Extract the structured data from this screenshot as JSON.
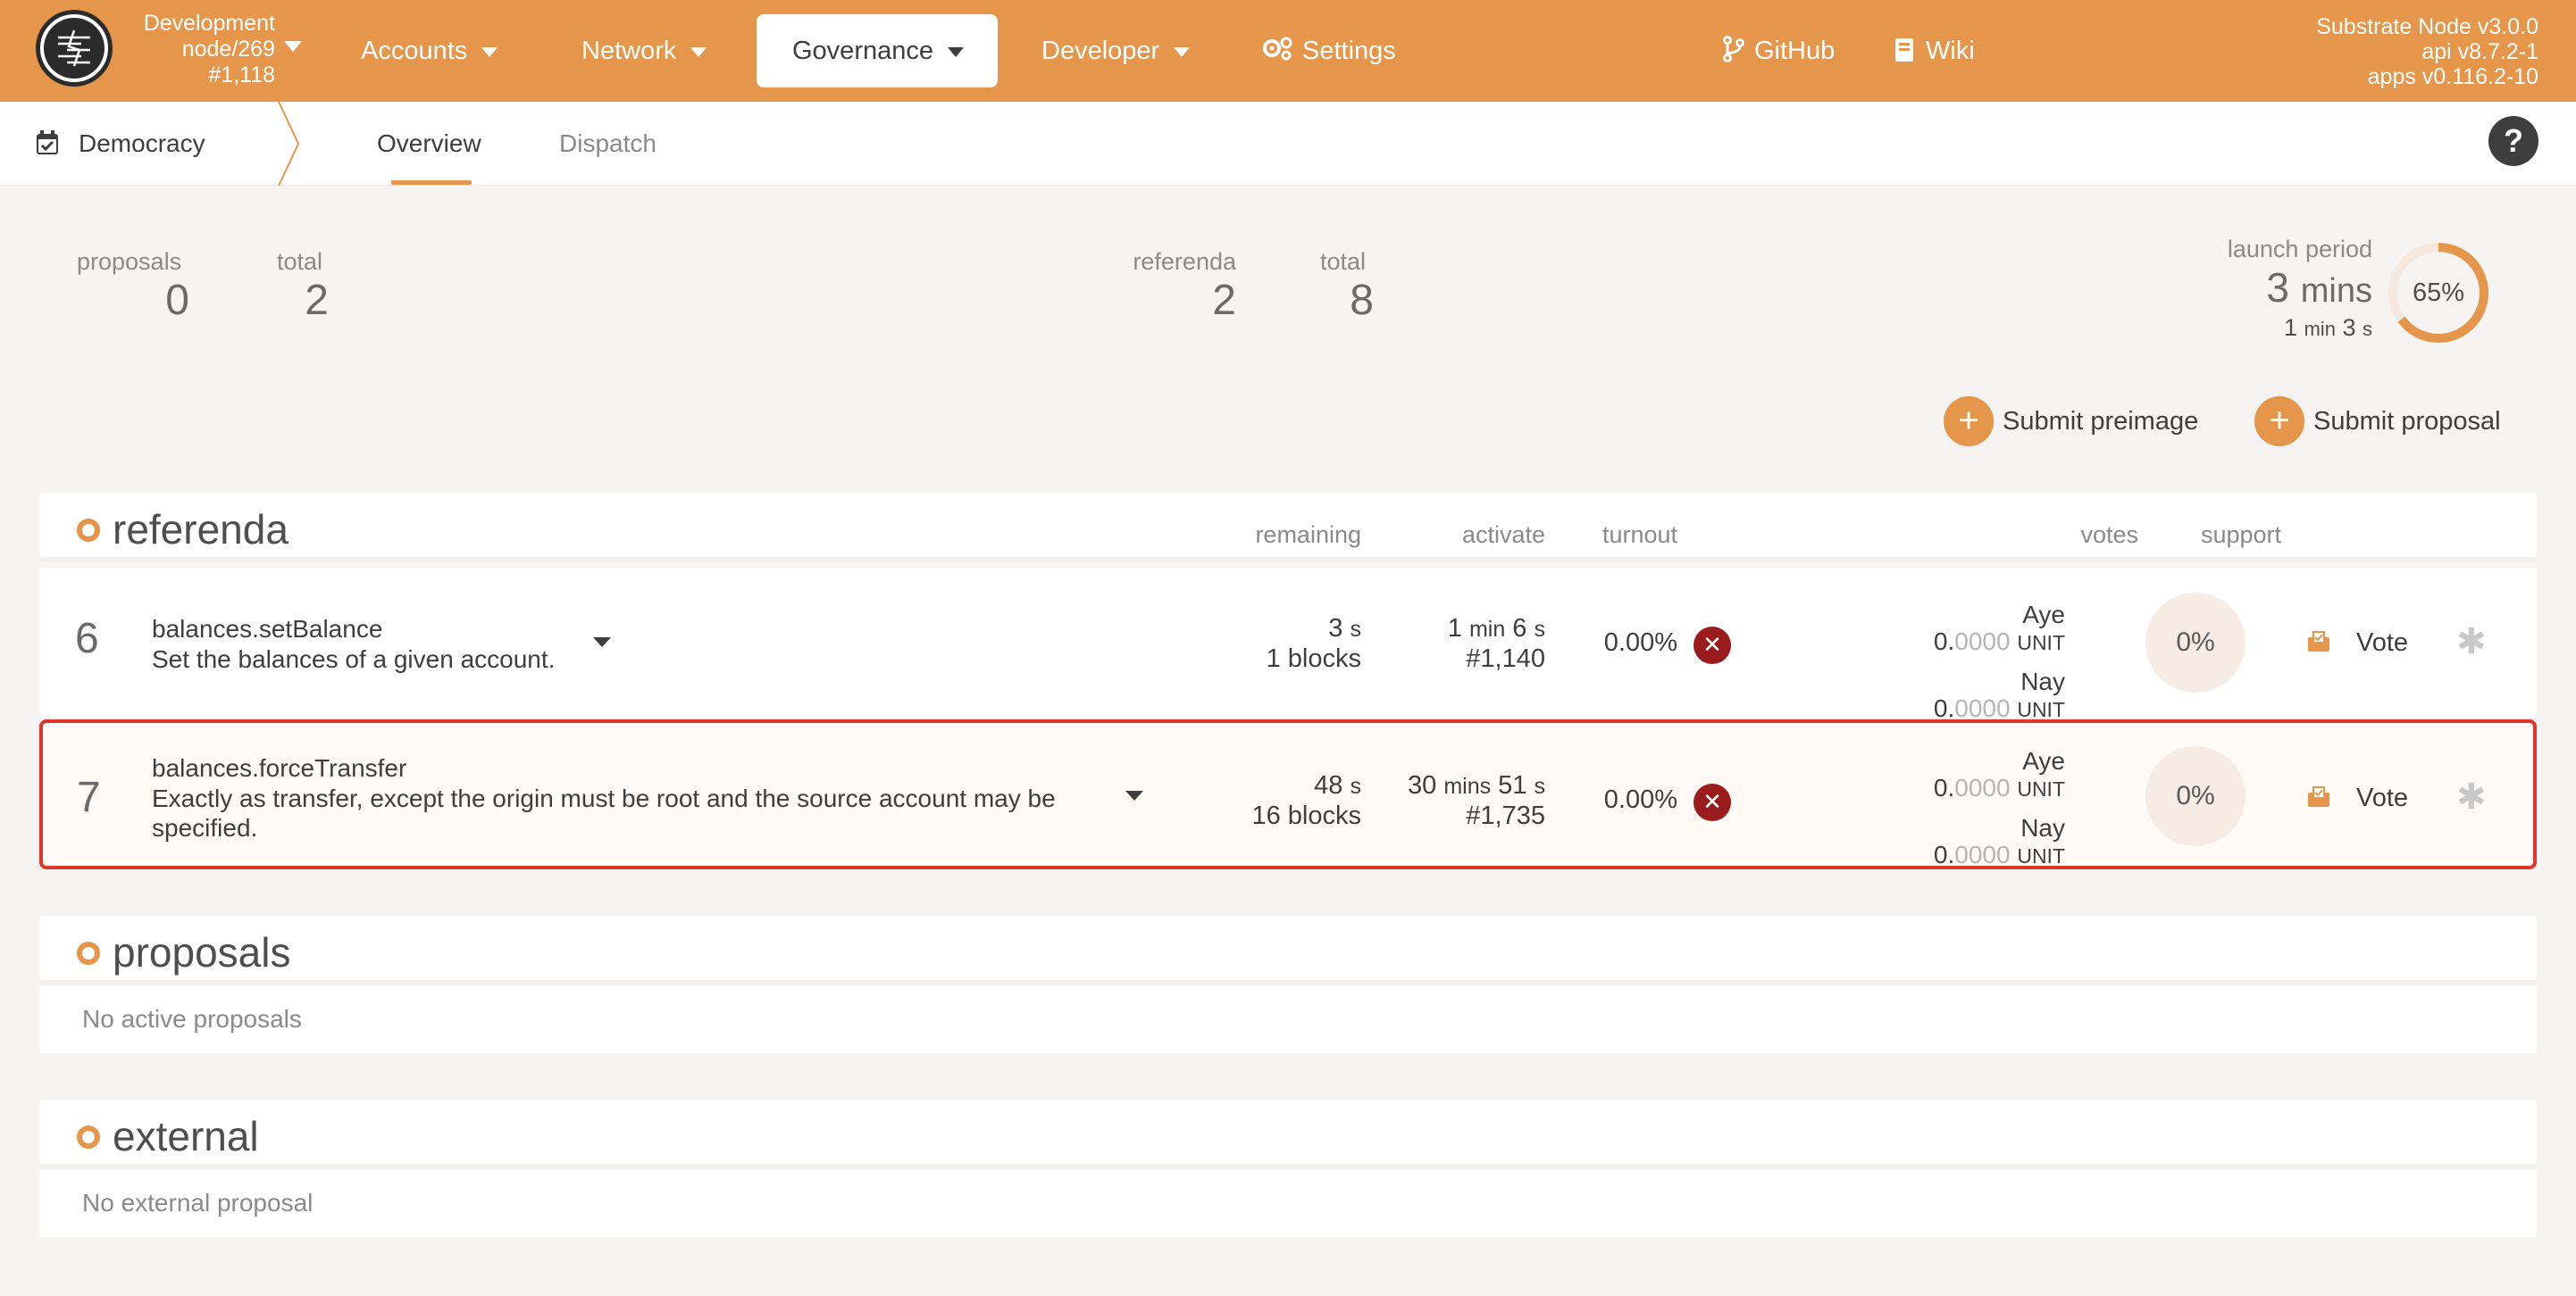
{
  "header": {
    "chain_name": "Development",
    "node": "node/269",
    "block": "#1,118",
    "nav": [
      "Accounts",
      "Network",
      "Governance",
      "Developer",
      "Settings"
    ],
    "github": "GitHub",
    "wiki": "Wiki",
    "version_node": "Substrate Node v3.0.0",
    "version_api": "api v8.7.2-1",
    "version_apps": "apps v0.116.2-10",
    "accent_color": "#e5964a"
  },
  "subnav": {
    "title": "Democracy",
    "tabs": [
      "Overview",
      "Dispatch"
    ],
    "help": "?"
  },
  "summary": {
    "proposals_label": "proposals",
    "proposals_value": "0",
    "proposals_total_label": "total",
    "proposals_total_value": "2",
    "referenda_label": "referenda",
    "referenda_value": "2",
    "referenda_total_label": "total",
    "referenda_total_value": "8",
    "launch_label": "launch period",
    "launch_big_num": "3",
    "launch_big_unit": "mins",
    "launch_small_min": "1",
    "launch_small_min_unit": "min",
    "launch_small_sec": "3",
    "launch_small_sec_unit": "s",
    "launch_percent_label": "65%",
    "launch_percent": 0.65
  },
  "actions": {
    "submit_preimage": "Submit preimage",
    "submit_proposal": "Submit proposal"
  },
  "referenda": {
    "title": "referenda",
    "columns": {
      "remaining": "remaining",
      "activate": "activate",
      "turnout": "turnout",
      "votes": "votes",
      "support": "support"
    },
    "rows": [
      {
        "index": "6",
        "call": "balances.setBalance",
        "description": "Set the balances of a given account.",
        "remaining_time": "3",
        "remaining_unit": "s",
        "remaining_blocks": "1 blocks",
        "activate_a": "1",
        "activate_a_unit": "min",
        "activate_b": "6",
        "activate_b_unit": "s",
        "activate_block": "#1,140",
        "turnout": "0.00%",
        "aye_label": "Aye",
        "aye_int": "0.",
        "aye_dec": "0000",
        "aye_unit": "UNIT",
        "nay_label": "Nay",
        "nay_int": "0.",
        "nay_dec": "0000",
        "nay_unit": "UNIT",
        "support": "0%",
        "vote": "Vote"
      },
      {
        "index": "7",
        "call": "balances.forceTransfer",
        "description": "Exactly as transfer, except the origin must be root and the source account may be specified.",
        "remaining_time": "48",
        "remaining_unit": "s",
        "remaining_blocks": "16 blocks",
        "activate_a": "30",
        "activate_a_unit": "mins",
        "activate_b": "51",
        "activate_b_unit": "s",
        "activate_block": "#1,735",
        "turnout": "0.00%",
        "aye_label": "Aye",
        "aye_int": "0.",
        "aye_dec": "0000",
        "aye_unit": "UNIT",
        "nay_label": "Nay",
        "nay_int": "0.",
        "nay_dec": "0000",
        "nay_unit": "UNIT",
        "support": "0%",
        "vote": "Vote"
      }
    ]
  },
  "proposals": {
    "title": "proposals",
    "empty": "No active proposals"
  },
  "external": {
    "title": "external",
    "empty": "No external proposal"
  }
}
